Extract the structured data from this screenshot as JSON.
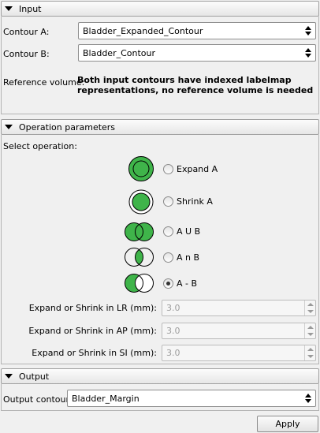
{
  "input": {
    "header": "Input",
    "contour_a_label": "Contour A:",
    "contour_a_value": "Bladder_Expanded_Contour",
    "contour_b_label": "Contour B:",
    "contour_b_value": "Bladder_Contour",
    "reference_label": "Reference volume:",
    "reference_message": "Both input contours have indexed labelmap representations, no reference volume is needed"
  },
  "operation": {
    "header": "Operation parameters",
    "select_label": "Select operation:",
    "options": [
      {
        "label": "Expand A",
        "checked": false
      },
      {
        "label": "Shrink A",
        "checked": false
      },
      {
        "label": "A U B",
        "checked": false
      },
      {
        "label": "A n B",
        "checked": false
      },
      {
        "label": "A - B",
        "checked": true
      }
    ],
    "margins": [
      {
        "label": "Expand or Shrink in LR (mm):",
        "value": "3.0"
      },
      {
        "label": "Expand or Shrink in AP (mm):",
        "value": "3.0"
      },
      {
        "label": "Expand or Shrink in SI (mm):",
        "value": "3.0"
      }
    ]
  },
  "output": {
    "header": "Output",
    "contour_label": "Output contour:",
    "contour_value": "Bladder_Margin"
  },
  "apply_label": "Apply",
  "colors": {
    "green": "#3fb44a",
    "outline": "#000000"
  }
}
